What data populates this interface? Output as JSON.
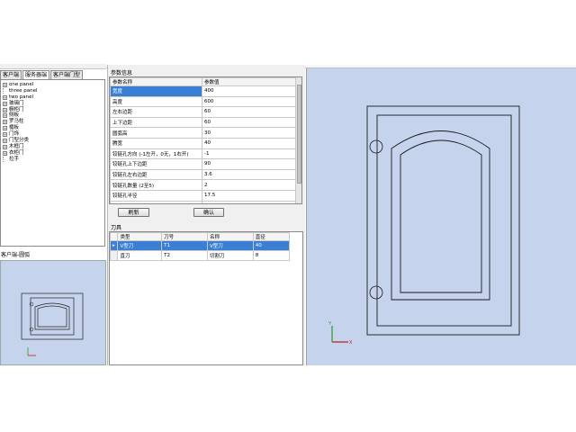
{
  "left_panel": {
    "top_strip_text": "",
    "tabs": [
      "客户端",
      "服务器端",
      "客户端门型"
    ],
    "tree": [
      {
        "label": "one panel",
        "expandable": true
      },
      {
        "label": "three panel",
        "expandable": false
      },
      {
        "label": "two panel",
        "expandable": true
      },
      {
        "label": "玻璃门",
        "expandable": true
      },
      {
        "label": "橱柜门",
        "expandable": true
      },
      {
        "label": "侧板",
        "expandable": true
      },
      {
        "label": "罗马柱",
        "expandable": true
      },
      {
        "label": "楣板",
        "expandable": true
      },
      {
        "label": "门饰",
        "expandable": true
      },
      {
        "label": "门型分类",
        "expandable": true
      },
      {
        "label": "木框门",
        "expandable": true
      },
      {
        "label": "衣柜门",
        "expandable": true
      },
      {
        "label": "拉手",
        "expandable": false
      }
    ],
    "preview_title": "客户端-圆弧"
  },
  "params": {
    "group_title": "参数信息",
    "col_name": "参数名称",
    "col_value": "参数值",
    "rows": [
      {
        "name": "宽度",
        "value": "400"
      },
      {
        "name": "高度",
        "value": "600"
      },
      {
        "name": "左右边距",
        "value": "60"
      },
      {
        "name": "上下边距",
        "value": "60"
      },
      {
        "name": "圆弧高",
        "value": "30"
      },
      {
        "name": "腾宽",
        "value": "40"
      },
      {
        "name": "铰链孔方向 (-1左开，0无，1右开)",
        "value": "-1"
      },
      {
        "name": "铰链孔上下边距",
        "value": "90"
      },
      {
        "name": "铰链孔左右边距",
        "value": "3.6"
      },
      {
        "name": "铰链孔数量 (2至5)",
        "value": "2"
      },
      {
        "name": "铰链孔半径",
        "value": "17.5"
      },
      {
        "name": "是否打小孔 (0否，1是)",
        "value": "0"
      }
    ],
    "selected_index": 0,
    "refresh_label": "刷新",
    "confirm_label": "确认"
  },
  "tools": {
    "group_title": "刀具",
    "headers": [
      "类型",
      "刀号",
      "名称",
      "直径"
    ],
    "rows": [
      {
        "type": "V型刀",
        "num": "T1",
        "name": "V型刀",
        "dia": "40"
      },
      {
        "type": "直刀",
        "num": "T2",
        "name": "切割刀",
        "dia": "8"
      }
    ],
    "selected_index": 0,
    "row_marker": "▸"
  },
  "canvas": {
    "axis_x": "X",
    "axis_y": "Y",
    "background": "#c5d3ec",
    "accent": "#3a7fd4"
  }
}
